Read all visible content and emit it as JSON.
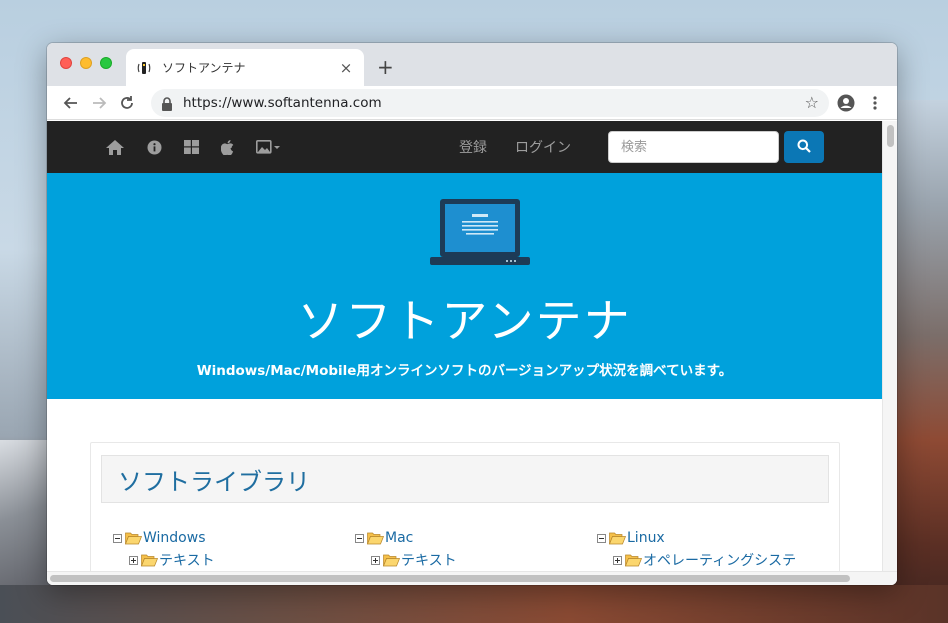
{
  "browser": {
    "tab_title": "ソフトアンテナ",
    "tab_close": "×",
    "new_tab": "+",
    "url": "https://www.softantenna.com"
  },
  "site": {
    "nav": {
      "icons": [
        "home-icon",
        "info-icon",
        "windows-icon",
        "apple-icon",
        "image-dropdown-icon"
      ],
      "register": "登録",
      "login": "ログイン",
      "search_placeholder": "検索"
    },
    "hero": {
      "title": "ソフトアンテナ",
      "subtitle": "Windows/Mac/Mobile用オンラインソフトのバージョンアップ状況を調べています。"
    },
    "library": {
      "title": "ソフトライブラリ",
      "columns": [
        {
          "root": "Windows",
          "child": "テキスト"
        },
        {
          "root": "Mac",
          "child": "テキスト"
        },
        {
          "root": "Linux",
          "child": "オペレーティングシステ"
        }
      ]
    }
  },
  "colors": {
    "hero_bg": "#00a1dc",
    "navbar_bg": "#222222",
    "link": "#1a6aa3",
    "search_btn": "#0b77b5"
  }
}
